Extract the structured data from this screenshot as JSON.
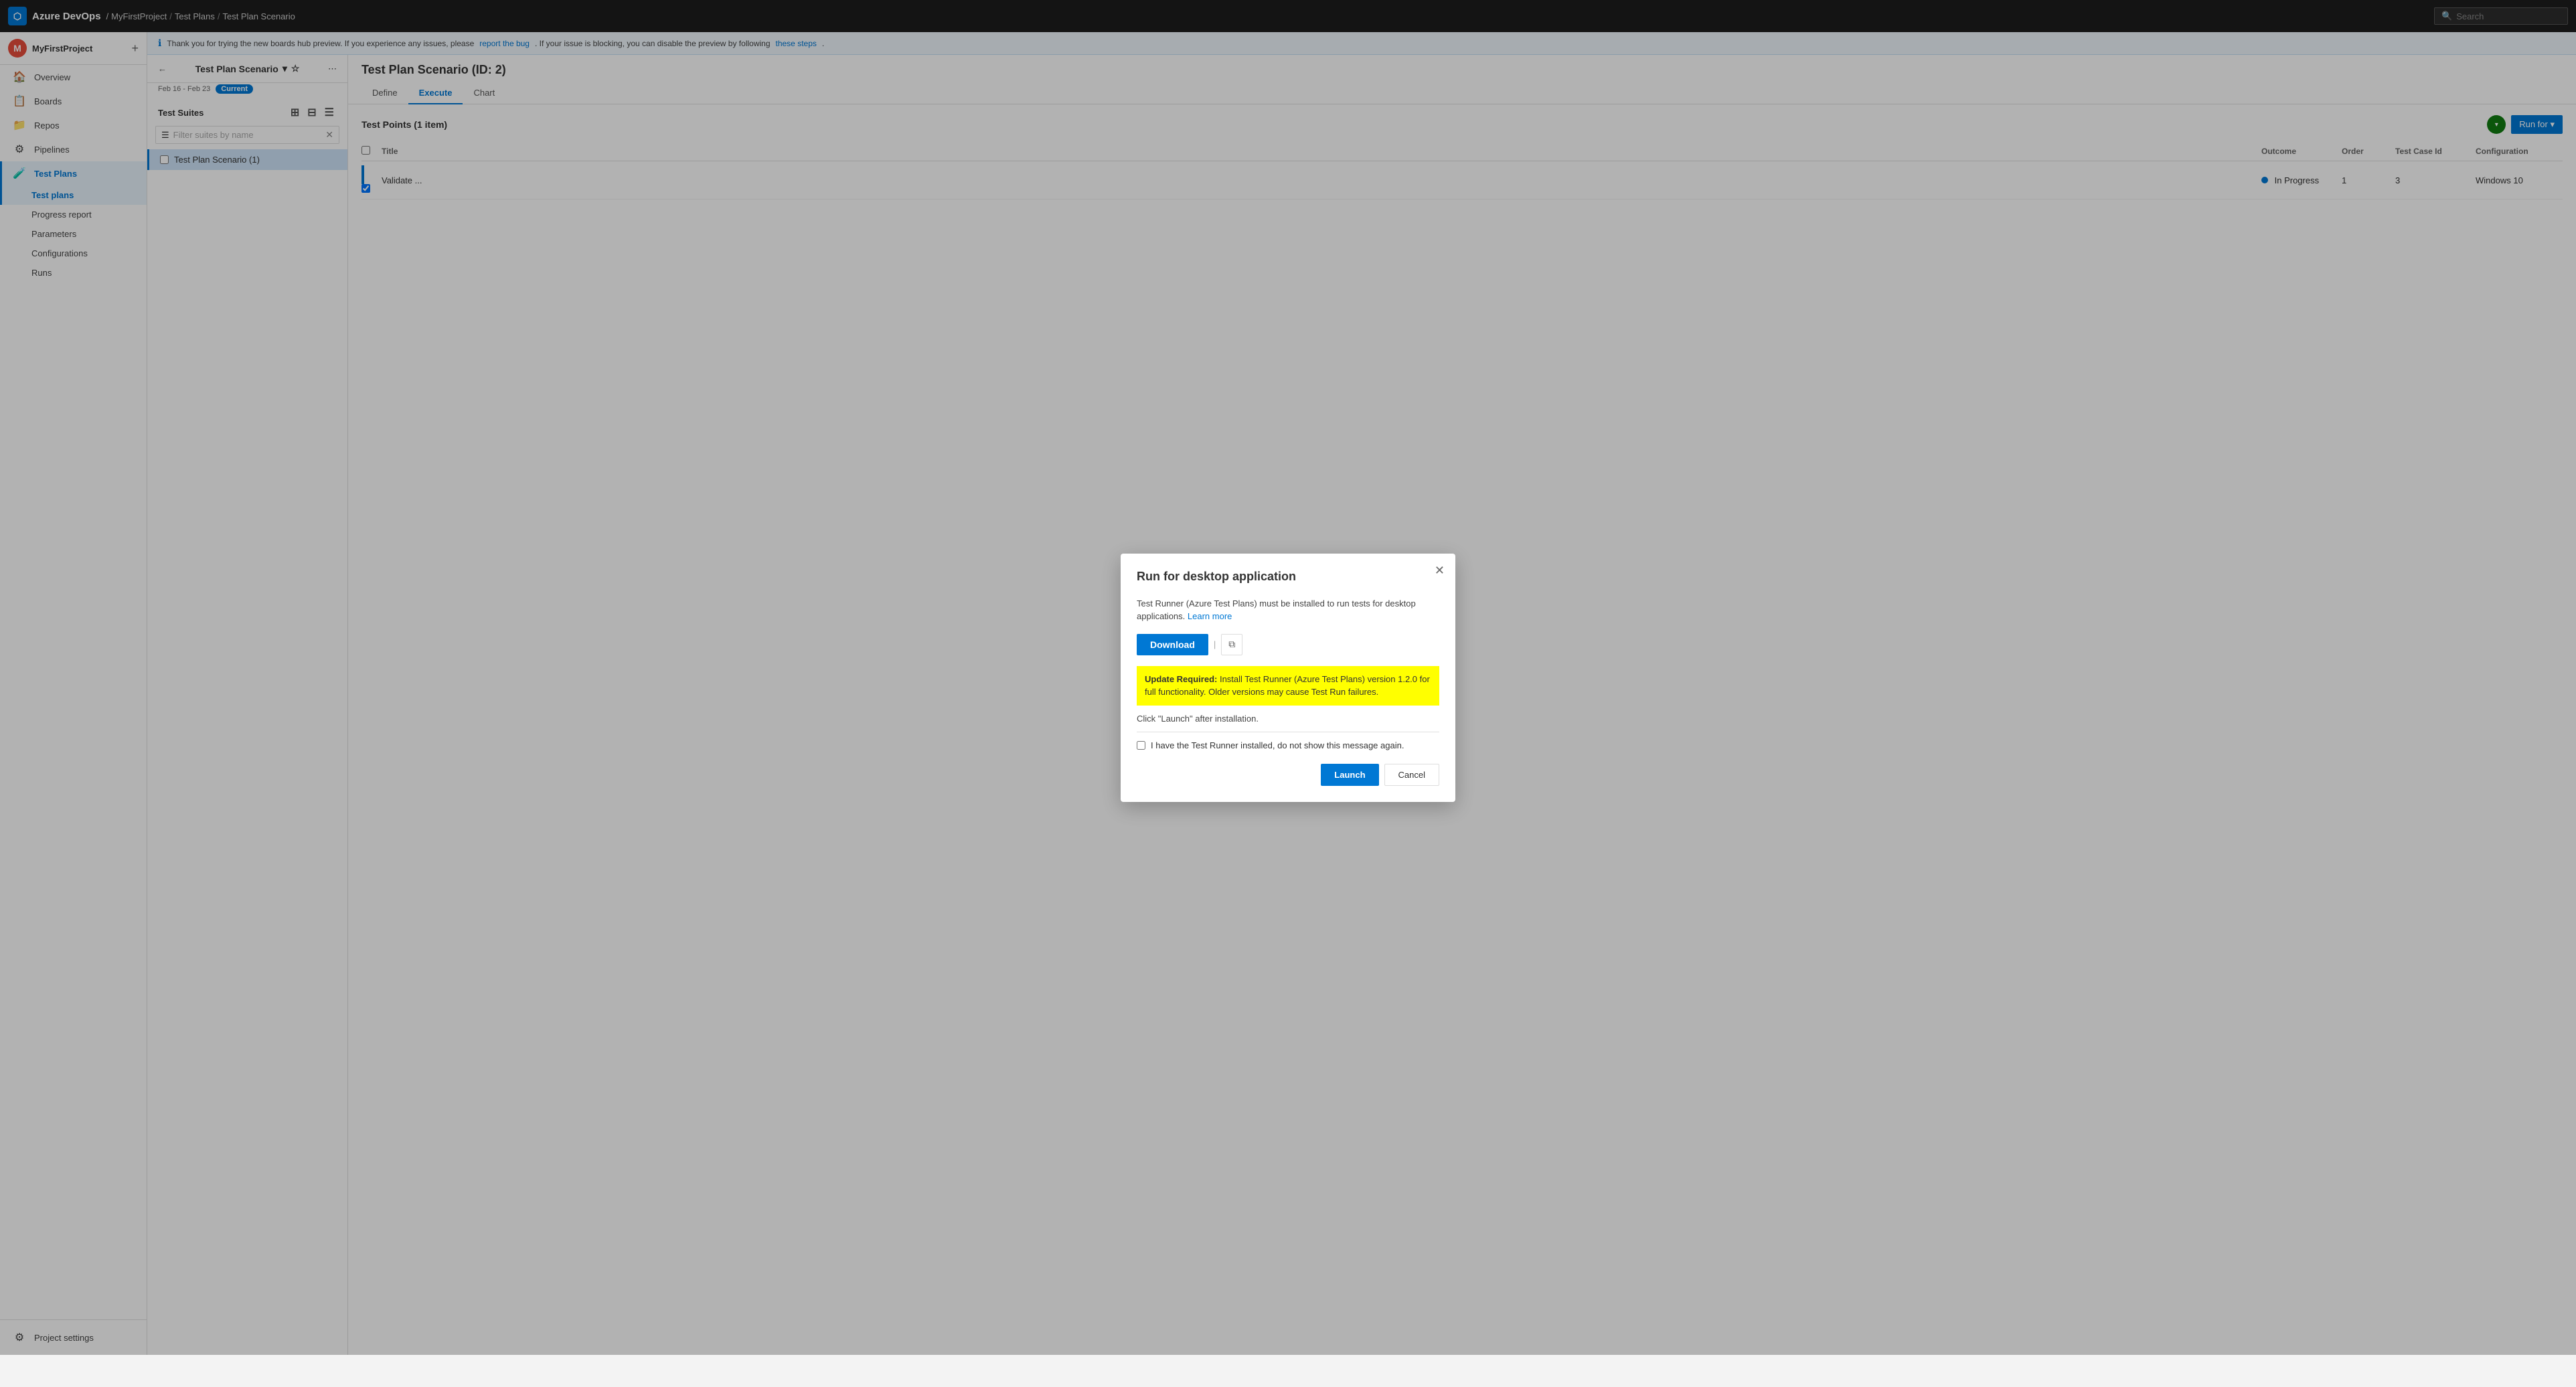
{
  "app": {
    "name": "Azure DevOps",
    "logo_letter": "⬡"
  },
  "breadcrumb": {
    "items": [
      "MyFirstProject",
      "Test Plans",
      "Test Plan Scenario"
    ]
  },
  "search": {
    "placeholder": "Search"
  },
  "sidebar": {
    "project": {
      "name": "MyFirstProject",
      "initial": "M"
    },
    "nav_items": [
      {
        "id": "overview",
        "label": "Overview",
        "icon": "🏠"
      },
      {
        "id": "boards",
        "label": "Boards",
        "icon": "📋"
      },
      {
        "id": "repos",
        "label": "Repos",
        "icon": "📁"
      },
      {
        "id": "pipelines",
        "label": "Pipelines",
        "icon": "⚙"
      },
      {
        "id": "test-plans",
        "label": "Test Plans",
        "icon": "🧪"
      }
    ],
    "sub_nav_items": [
      {
        "id": "test-plans-sub",
        "label": "Test plans"
      },
      {
        "id": "progress-report",
        "label": "Progress report"
      },
      {
        "id": "parameters",
        "label": "Parameters"
      },
      {
        "id": "configurations",
        "label": "Configurations"
      },
      {
        "id": "runs",
        "label": "Runs"
      }
    ],
    "bottom": {
      "project_settings": "Project settings"
    }
  },
  "info_banner": {
    "text": "Thank you for trying the new boards hub preview. If you experience any issues, please",
    "link1_text": "report the bug",
    "middle_text": ". If your issue is blocking, you can disable the preview by following",
    "link2_text": "these steps",
    "end_text": "."
  },
  "left_panel": {
    "back_label": "←",
    "plan_name": "Test Plan Scenario",
    "plan_date": "Feb 16 - Feb 23",
    "current_badge": "Current",
    "more_icon": "⋯",
    "star_icon": "☆",
    "dropdown_icon": "▾",
    "suites_label": "Test Suites",
    "filter_placeholder": "Filter suites by name",
    "suite_item": "Test Plan Scenario (1)"
  },
  "right_panel": {
    "title": "Test Plan Scenario (ID: 2)",
    "tabs": [
      {
        "id": "define",
        "label": "Define"
      },
      {
        "id": "execute",
        "label": "Execute",
        "active": true
      },
      {
        "id": "chart",
        "label": "Chart"
      }
    ],
    "test_points_title": "Test Points (1 item)",
    "table": {
      "headers": [
        "",
        "Title",
        "Outcome",
        "Order",
        "Test Case Id",
        "Configuration"
      ],
      "rows": [
        {
          "checked": true,
          "title": "Validate ...",
          "outcome": "In Progress",
          "order": "1",
          "case_id": "3",
          "configuration": "Windows 10"
        }
      ]
    }
  },
  "modal": {
    "title": "Run for desktop application",
    "body_text": "Test Runner (Azure Test Plans) must be installed to run tests for desktop applications.",
    "learn_more": "Learn more",
    "download_label": "Download",
    "update_warning": {
      "prefix": "Update Required:",
      "message": "Install Test Runner (Azure Test Plans) version 1.2.0 for full functionality. Older versions may cause Test Run failures."
    },
    "launch_note": "Click \"Launch\" after installation.",
    "checkbox_label": "I have the Test Runner installed, do not show this message again.",
    "launch_btn": "Launch",
    "cancel_btn": "Cancel"
  }
}
